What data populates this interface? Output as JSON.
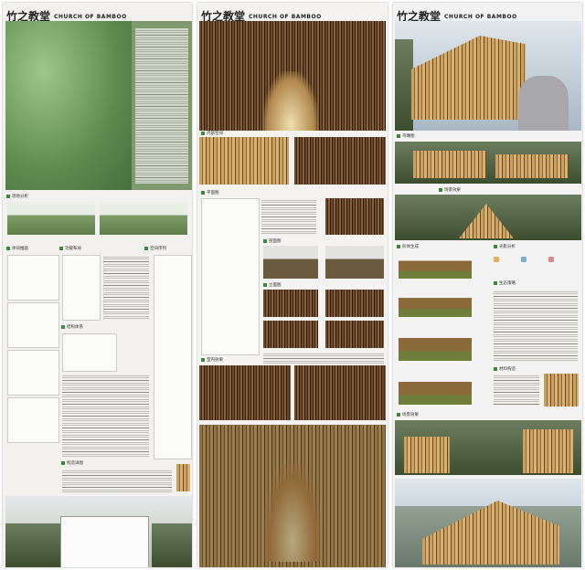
{
  "boards": [
    {
      "title_cn": "竹之教堂",
      "title_en": "CHURCH OF BAMBOO",
      "sections": [
        "场地分析",
        "体块推敲",
        "功能布局",
        "空间序列",
        "结构体系",
        "构造详图"
      ]
    },
    {
      "title_cn": "竹之教堂",
      "title_en": "CHURCH OF BAMBOO",
      "sections": [
        "内部空间",
        "平面图",
        "剖面图",
        "立面图",
        "室内效果"
      ]
    },
    {
      "title_cn": "竹之教堂",
      "title_en": "CHURCH OF BAMBOO",
      "sections": [
        "鸟瞰图",
        "场景效果",
        "形体生成",
        "光影分析",
        "生态策略",
        "材料构造"
      ]
    }
  ],
  "colors": {
    "accent": "#3a8a3a",
    "bamboo": "#c8a060",
    "dark_wood": "#3a2815"
  }
}
